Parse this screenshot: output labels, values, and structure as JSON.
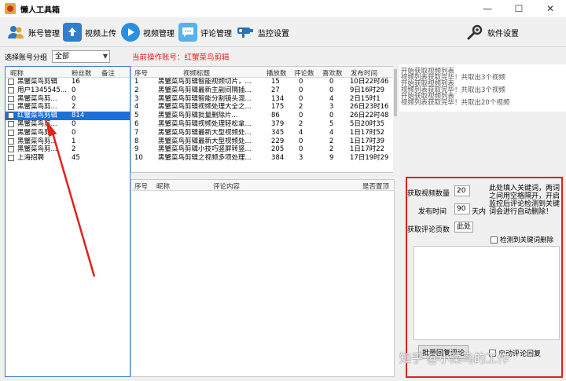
{
  "window": {
    "title": "懒人工具箱",
    "minimize": "—",
    "maximize": "☐",
    "close": "✕"
  },
  "toolbar": {
    "account": "账号管理",
    "upload": "视频上传",
    "videos": "视频管理",
    "comments": "评论管理",
    "monitor": "监控设置",
    "settings": "软件设置"
  },
  "group": {
    "label": "选择账号分组",
    "value": "全部"
  },
  "current": {
    "label": "当前操作账号：",
    "account": "红蟹菜鸟剪辑"
  },
  "accounts": {
    "headers": {
      "nick": "昵称",
      "fans": "粉丝数",
      "note": "备注"
    },
    "rows": [
      {
        "nick": "黑蟹菜鸟剪辑",
        "fans": "16",
        "selected": false
      },
      {
        "nick": "用户1345545...",
        "fans": "0",
        "selected": false
      },
      {
        "nick": "黑蟹菜鸟剪...",
        "fans": "0",
        "selected": false
      },
      {
        "nick": "黑蟹菜鸟剪...",
        "fans": "2",
        "selected": false
      },
      {
        "nick": "红蟹菜鸟剪辑",
        "fans": "814",
        "selected": true
      },
      {
        "nick": "黑蟹菜鸟剪...",
        "fans": "0",
        "selected": false
      },
      {
        "nick": "黑蟹菜鸟剪...",
        "fans": "0",
        "selected": false
      },
      {
        "nick": "黑蟹菜鸟剪...",
        "fans": "1",
        "selected": false
      },
      {
        "nick": "黑蟹菜鸟剪...",
        "fans": "2",
        "selected": false
      },
      {
        "nick": "上海招聘",
        "fans": "45",
        "selected": false
      }
    ]
  },
  "videos": {
    "headers": {
      "no": "序号",
      "title": "视频标题",
      "plays": "播放数",
      "comments": "评论数",
      "likes": "喜欢数",
      "time": "发布时间"
    },
    "rows": [
      {
        "no": "1",
        "title": "黑蟹菜鸟剪辑智能视频切片，...",
        "plays": "15",
        "comments": "0",
        "likes": "0",
        "time": "10日22时46"
      },
      {
        "no": "2",
        "title": "黑蟹菜鸟剪辑最新主副间隔插...",
        "plays": "27",
        "comments": "0",
        "likes": "0",
        "time": "9日16时29"
      },
      {
        "no": "3",
        "title": "黑蟹菜鸟剪辑智能分割镜头混...",
        "plays": "134",
        "comments": "0",
        "likes": "4",
        "time": "2日15时1"
      },
      {
        "no": "4",
        "title": "黑蟹菜鸟剪辑视频处理大全之...",
        "plays": "175",
        "comments": "2",
        "likes": "3",
        "time": "26日23时16"
      },
      {
        "no": "5",
        "title": "黑蟹菜鸟剪辑批量删除片...",
        "plays": "86",
        "comments": "0",
        "likes": "0",
        "time": "26日22时48"
      },
      {
        "no": "6",
        "title": "黑蟹菜鸟剪辑视频处理轻松拿...",
        "plays": "379",
        "comments": "2",
        "likes": "5",
        "time": "5日20时35"
      },
      {
        "no": "7",
        "title": "黑蟹菜鸟剪辑最新大型视频处...",
        "plays": "345",
        "comments": "4",
        "likes": "4",
        "time": "1日17时52"
      },
      {
        "no": "8",
        "title": "黑蟹菜鸟剪辑最新大型视频处...",
        "plays": "229",
        "comments": "0",
        "likes": "2",
        "time": "1日17时39"
      },
      {
        "no": "9",
        "title": "黑蟹菜鸟剪辑小技巧竖屏转竖...",
        "plays": "205",
        "comments": "0",
        "likes": "2",
        "time": "1日17时22"
      },
      {
        "no": "10",
        "title": "黑蟹菜鸟剪辑之视频多项处理...",
        "plays": "384",
        "comments": "3",
        "likes": "9",
        "time": "17日19时29"
      }
    ]
  },
  "log": [
    "开始获取视频列表",
    "视频列表获取完毕！共取出3个视频",
    "开始获取视频列表",
    "视频列表获取完毕！共取出3个视频",
    "开始获取视频列表",
    "视频列表获取完毕！共取出20个视频"
  ],
  "comment_table": {
    "no": "序号",
    "nick": "昵称",
    "content": "评论内容",
    "replied": "是否置顶"
  },
  "settings": {
    "count_label": "获取视频数量",
    "count_value": "20",
    "time_label": "发布时间",
    "time_value": "90",
    "time_unit": "天内",
    "pages_label": "获取评论页数",
    "pages_value": "此处",
    "hint": "此处填入关键词，两词之间用空格隔开，开启监控后评论检测到关键词会进行自动删除！",
    "detect_label": "检测到关键词删除",
    "bulk_button": "批量回复评论",
    "auto_label": "自动评论回复"
  },
  "watermark": "知乎 @小菜鸟的工作"
}
